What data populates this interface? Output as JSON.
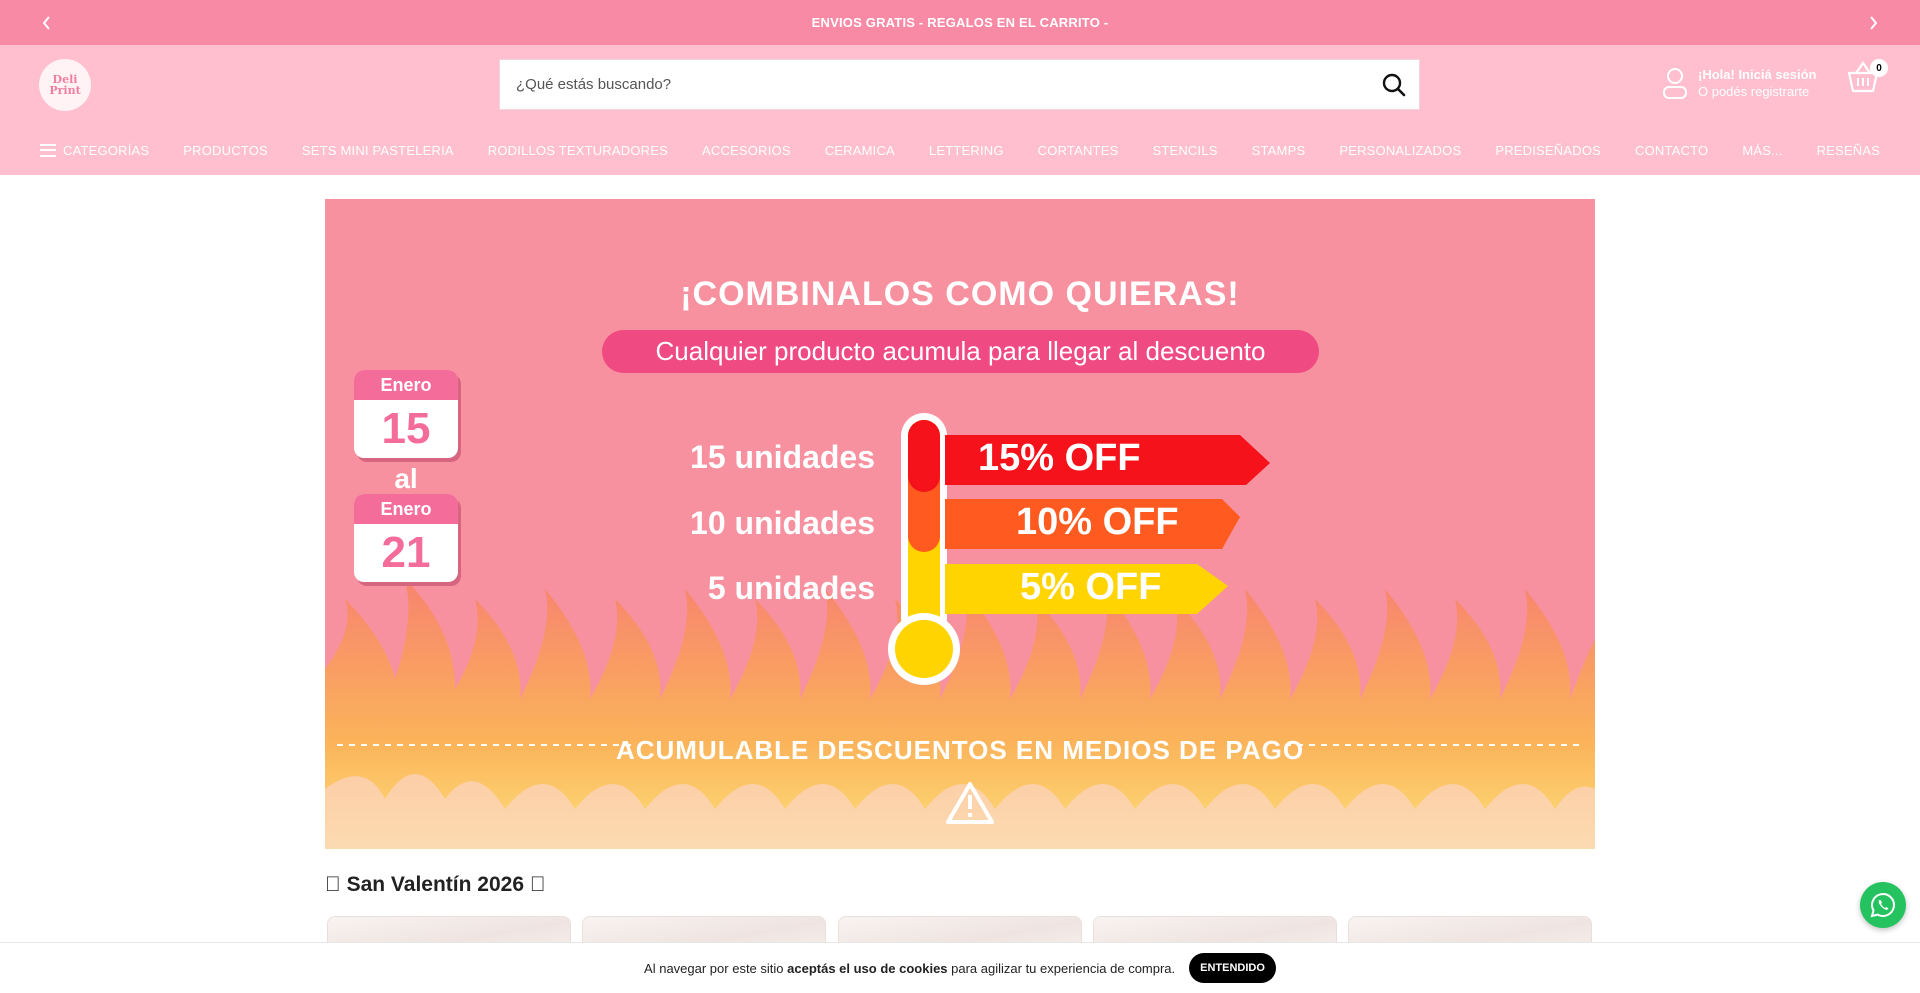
{
  "announcement": {
    "text": "ENVIOS GRATIS - REGALOS EN EL CARRITO -"
  },
  "header": {
    "logo_line1": "Deli",
    "logo_line2": "Print",
    "search_placeholder": "¿Qué estás buscando?",
    "account_line1": "¡Hola! Iniciá sesión",
    "account_line2": "O podés registrarte",
    "cart_count": "0"
  },
  "nav": {
    "categories_label": "CATEGORÍAS",
    "items": [
      "PRODUCTOS",
      "SETS MINI PASTELERIA",
      "RODILLOS TEXTURADORES",
      "ACCESORIOS",
      "CERAMICA",
      "LETTERING",
      "CORTANTES",
      "STENCILS",
      "STAMPS",
      "PERSONALIZADOS",
      "PREDISEÑADOS",
      "CONTACTO",
      "MÁS...",
      "RESEÑAS"
    ]
  },
  "banner": {
    "headline": "¡COMBINALOS COMO QUIERAS!",
    "pill_text": "Cualquier producto acumula para llegar al descuento",
    "date_from_month": "Enero",
    "date_from_day": "15",
    "date_connector": "al",
    "date_to_month": "Enero",
    "date_to_day": "21",
    "tiers": [
      {
        "units": "15 unidades",
        "discount": "15% OFF",
        "color": "#f5121b"
      },
      {
        "units": "10 unidades",
        "discount": "10% OFF",
        "color": "#ff5a1f"
      },
      {
        "units": "5 unidades",
        "discount": "5% OFF",
        "color": "#ffd400"
      }
    ],
    "footer_text": "ACUMULABLE DESCUENTOS EN MEDIOS DE PAGO"
  },
  "section": {
    "title": "\u0000 San Valentín 2026 \u0000"
  },
  "cookie": {
    "text_before": "Al navegar por este sitio ",
    "text_bold": "aceptás el uso de cookies",
    "text_after": " para agilizar tu experiencia de compra.",
    "button": "ENTENDIDO"
  },
  "colors": {
    "brand_pink": "#f88aa6",
    "header_pink": "#ffbfcf",
    "whatsapp": "#25c35f"
  },
  "icons": [
    "chevron-left-icon",
    "chevron-right-icon",
    "search-icon",
    "user-icon",
    "basket-icon",
    "hamburger-icon",
    "whatsapp-icon",
    "warning-icon"
  ]
}
